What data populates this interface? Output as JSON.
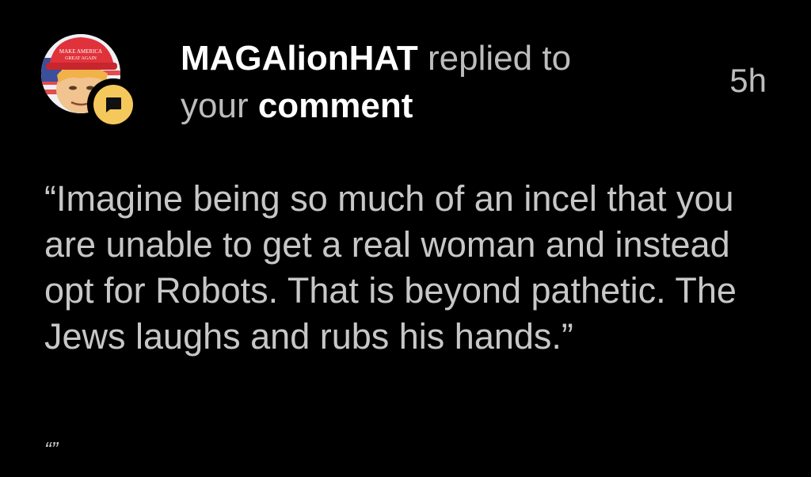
{
  "notification": {
    "username": "MAGAlionHAT",
    "action_text": "replied to",
    "your_text": "your",
    "object_text": "comment",
    "timestamp": "5h",
    "comment_body": "“Imagine being so much of an incel that you are unable to get a real woman and instead opt for Robots. That is beyond pathetic. The Jews laughs and rubs his hands.”",
    "quoted_reference": "“”",
    "avatar": {
      "icon": "user-avatar",
      "hat_text_line1": "MAKE AMERICA",
      "hat_text_line2": "GREAT AGAIN"
    },
    "badge": {
      "icon": "reply-bubble-icon",
      "color": "#f5c85b"
    }
  },
  "colors": {
    "background": "#000000",
    "text_primary": "#ffffff",
    "text_secondary": "#bdbdbd",
    "badge_yellow": "#f5c85b",
    "hat_red": "#e0323a"
  }
}
